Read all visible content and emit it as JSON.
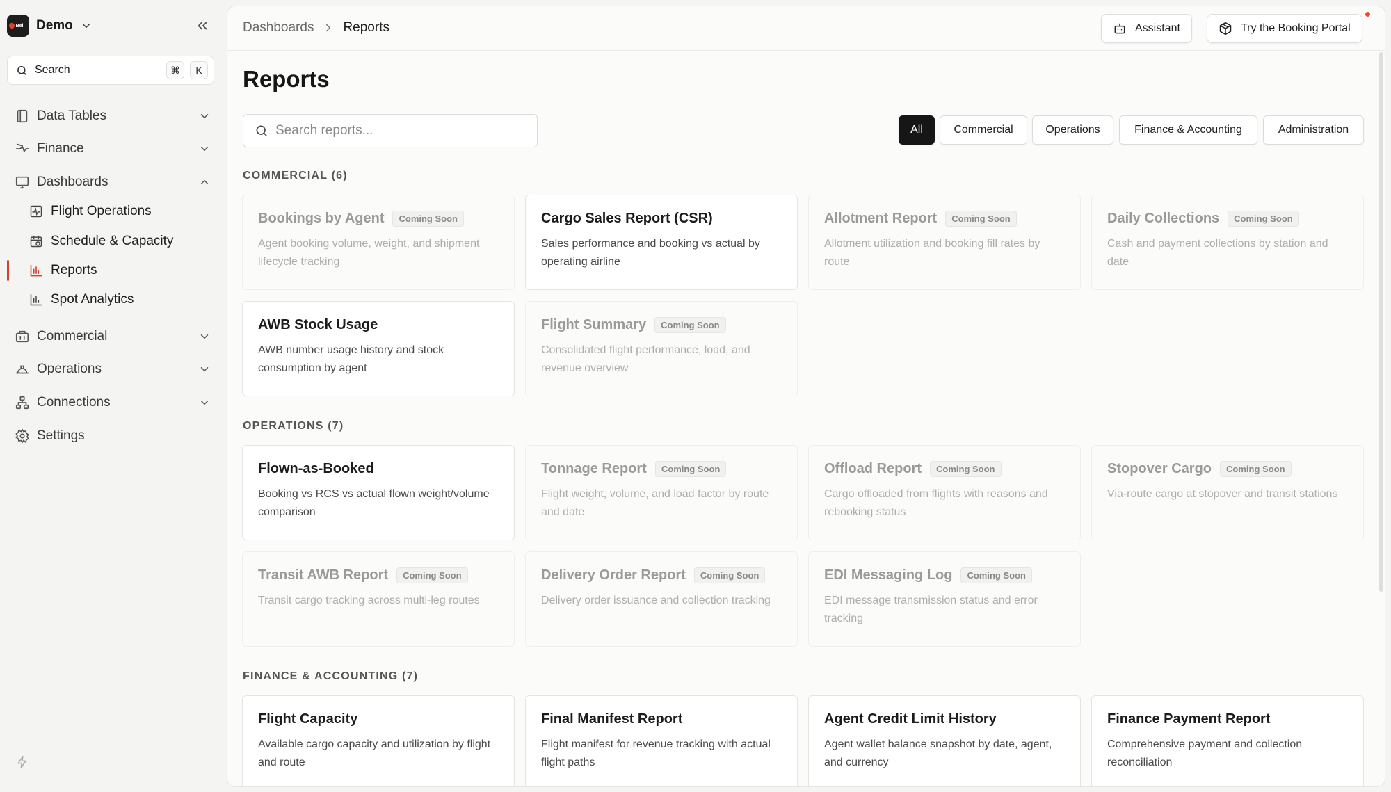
{
  "workspace": {
    "name": "Demo",
    "logo_text": "Bell"
  },
  "sidebar": {
    "search_label": "Search",
    "search_kbd": [
      "⌘",
      "K"
    ],
    "items": [
      {
        "label": "Data Tables",
        "icon": "data-tables-icon",
        "expanded": false
      },
      {
        "label": "Finance",
        "icon": "finance-icon",
        "expanded": false
      },
      {
        "label": "Dashboards",
        "icon": "dashboards-icon",
        "expanded": true
      },
      {
        "label": "Commercial",
        "icon": "commercial-icon",
        "expanded": false
      },
      {
        "label": "Operations",
        "icon": "operations-icon",
        "expanded": false
      },
      {
        "label": "Connections",
        "icon": "connections-icon",
        "expanded": false
      },
      {
        "label": "Settings",
        "icon": "gear-icon"
      }
    ],
    "dashboard_subitems": [
      {
        "label": "Flight Operations",
        "icon": "pulse-chart-icon"
      },
      {
        "label": "Schedule & Capacity",
        "icon": "calendar-clock-icon"
      },
      {
        "label": "Reports",
        "icon": "bar-chart-icon",
        "active": true
      },
      {
        "label": "Spot Analytics",
        "icon": "bar-chart-icon"
      }
    ]
  },
  "header": {
    "breadcrumb": [
      "Dashboards",
      "Reports"
    ],
    "assistant_label": "Assistant",
    "portal_label": "Try the Booking Portal"
  },
  "page": {
    "title": "Reports",
    "search_placeholder": "Search reports...",
    "filters": [
      "All",
      "Commercial",
      "Operations",
      "Finance & Accounting",
      "Administration"
    ],
    "active_filter": "All",
    "coming_soon_label": "Coming Soon"
  },
  "sections": [
    {
      "title": "COMMERCIAL (6)",
      "cards": [
        {
          "title": "Bookings by Agent",
          "desc": "Agent booking volume, weight, and shipment lifecycle tracking",
          "soon": true
        },
        {
          "title": "Cargo Sales Report (CSR)",
          "desc": "Sales performance and booking vs actual by operating airline",
          "soon": false
        },
        {
          "title": "Allotment Report",
          "desc": "Allotment utilization and booking fill rates by route",
          "soon": true
        },
        {
          "title": "Daily Collections",
          "desc": "Cash and payment collections by station and date",
          "soon": true
        },
        {
          "title": "AWB Stock Usage",
          "desc": "AWB number usage history and stock consumption by agent",
          "soon": false
        },
        {
          "title": "Flight Summary",
          "desc": "Consolidated flight performance, load, and revenue overview",
          "soon": true
        }
      ]
    },
    {
      "title": "OPERATIONS (7)",
      "cards": [
        {
          "title": "Flown-as-Booked",
          "desc": "Booking vs RCS vs actual flown weight/volume comparison",
          "soon": false
        },
        {
          "title": "Tonnage Report",
          "desc": "Flight weight, volume, and load factor by route and date",
          "soon": true
        },
        {
          "title": "Offload Report",
          "desc": "Cargo offloaded from flights with reasons and rebooking status",
          "soon": true
        },
        {
          "title": "Stopover Cargo",
          "desc": "Via-route cargo at stopover and transit stations",
          "soon": true
        },
        {
          "title": "Transit AWB Report",
          "desc": "Transit cargo tracking across multi-leg routes",
          "soon": true
        },
        {
          "title": "Delivery Order Report",
          "desc": "Delivery order issuance and collection tracking",
          "soon": true
        },
        {
          "title": "EDI Messaging Log",
          "desc": "EDI message transmission status and error tracking",
          "soon": true
        }
      ]
    },
    {
      "title": "FINANCE & ACCOUNTING (7)",
      "cards": [
        {
          "title": "Flight Capacity",
          "desc": "Available cargo capacity and utilization by flight and route",
          "soon": false
        },
        {
          "title": "Final Manifest Report",
          "desc": "Flight manifest for revenue tracking with actual flight paths",
          "soon": false
        },
        {
          "title": "Agent Credit Limit History",
          "desc": "Agent wallet balance snapshot by date, agent, and currency",
          "soon": false
        },
        {
          "title": "Finance Payment Report",
          "desc": "Comprehensive payment and collection reconciliation",
          "soon": false
        }
      ]
    }
  ],
  "colors": {
    "accent": "#d9402a",
    "active_filter_bg": "#161616",
    "notification": "#ec4b2c"
  }
}
